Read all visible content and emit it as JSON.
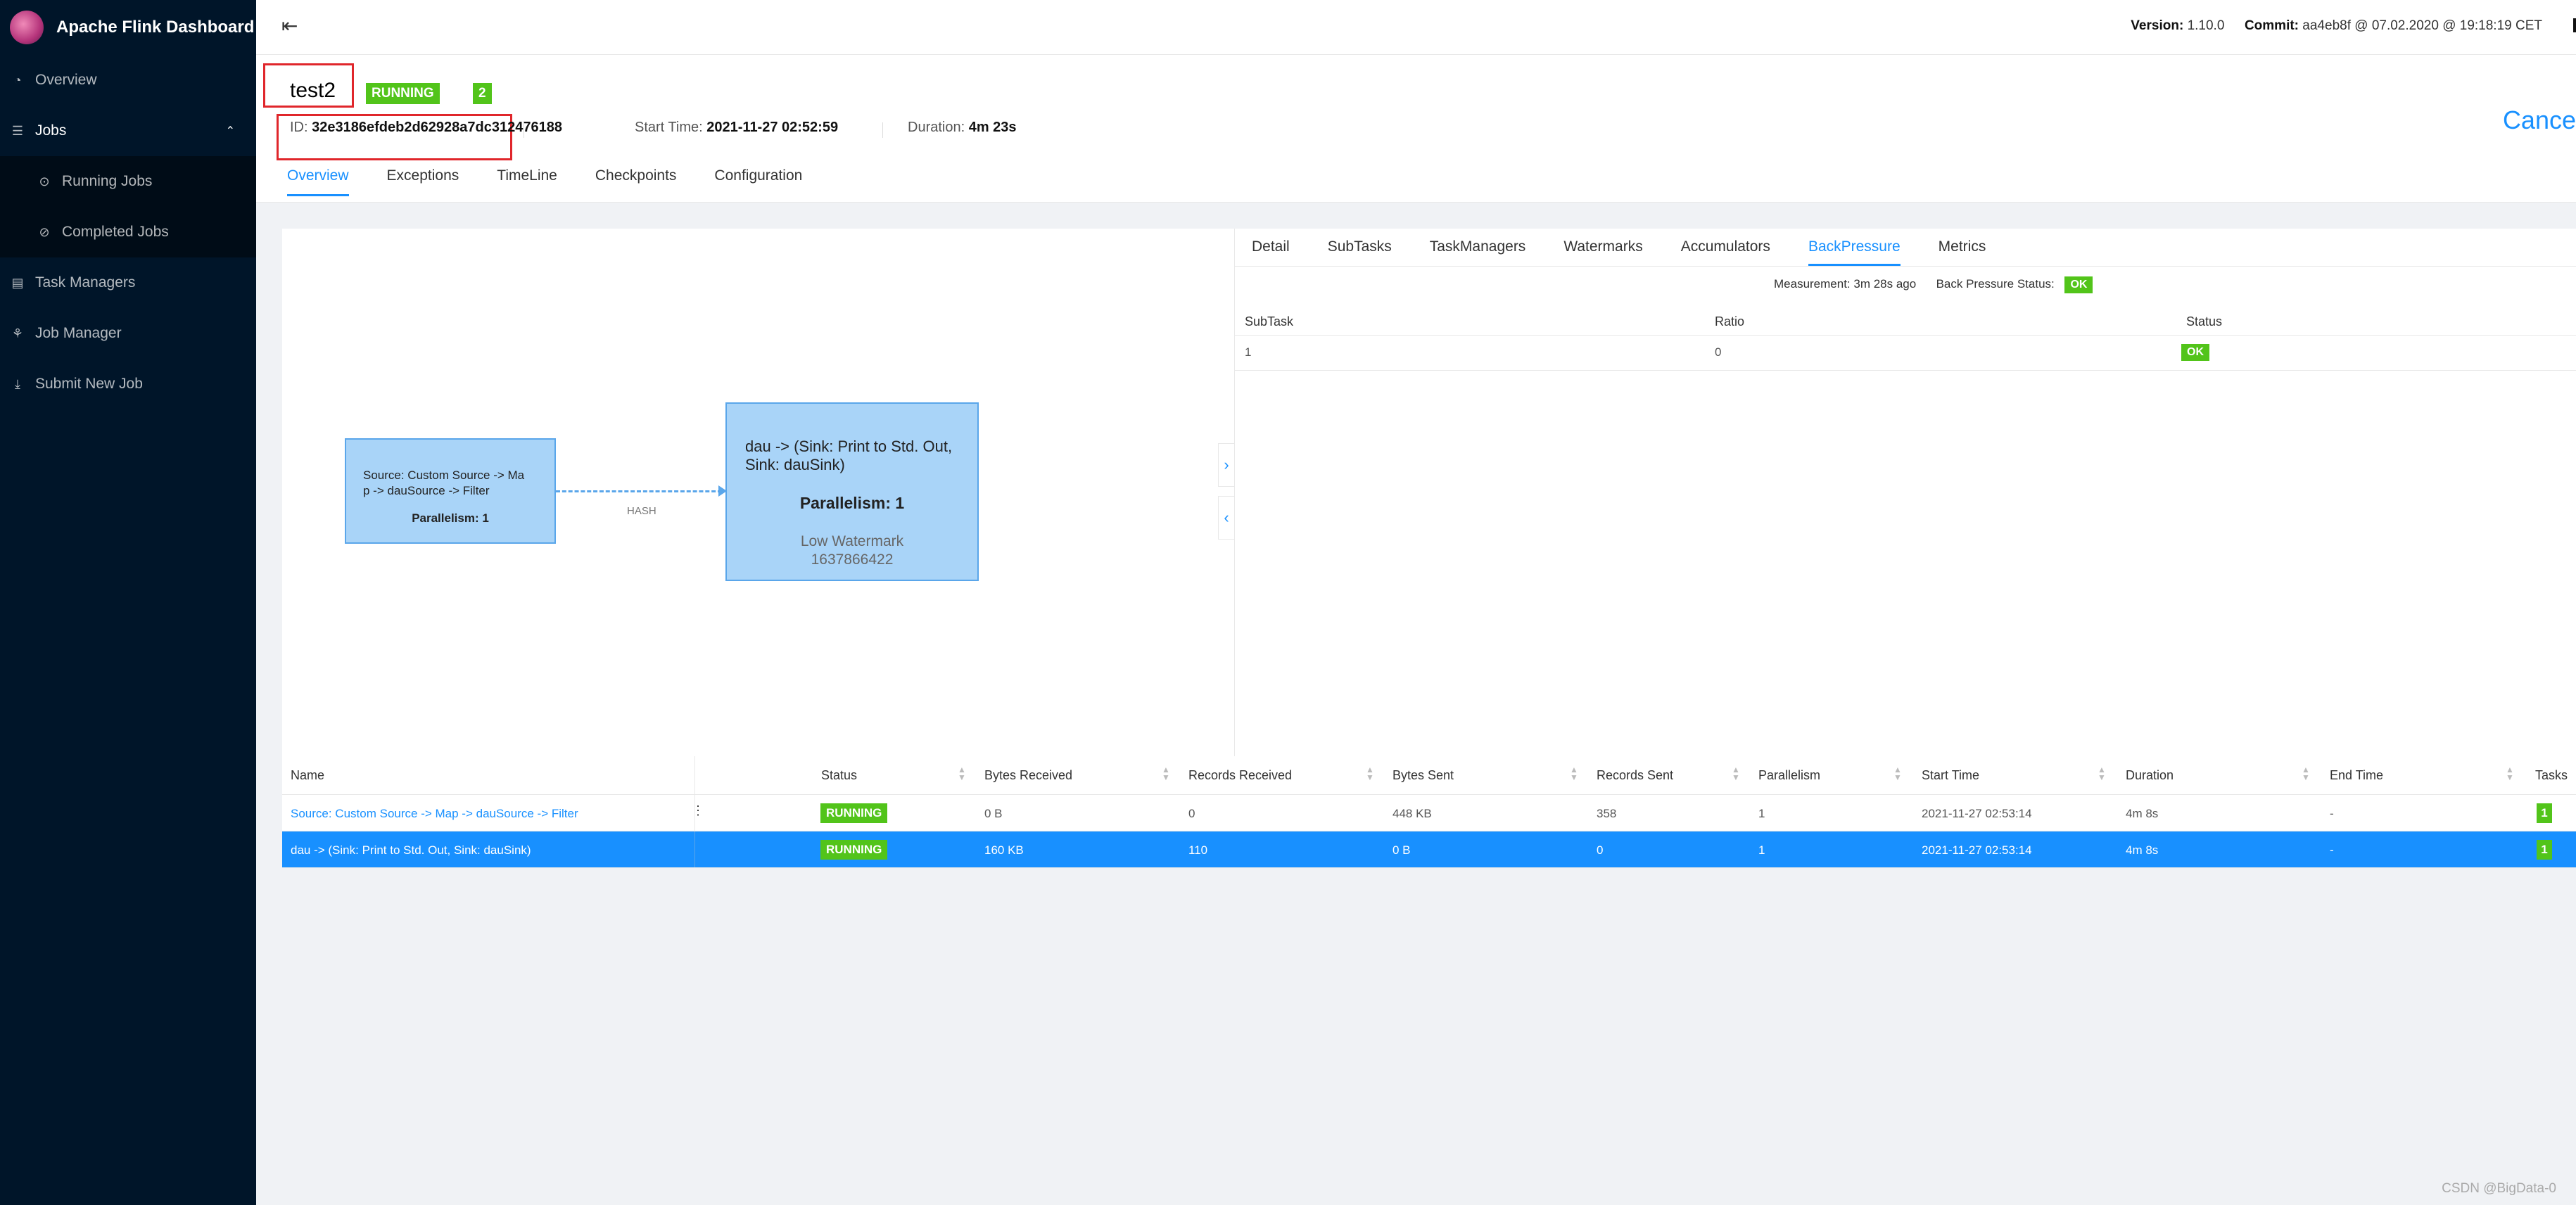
{
  "app": {
    "title": "Apache Flink Dashboard"
  },
  "sidebar": {
    "items": [
      {
        "label": "Overview",
        "icon": "dashboard-icon"
      },
      {
        "label": "Jobs",
        "icon": "jobs-icon"
      },
      {
        "label": "Running Jobs",
        "icon": "play-circle-icon"
      },
      {
        "label": "Completed Jobs",
        "icon": "check-circle-icon"
      },
      {
        "label": "Task Managers",
        "icon": "schedule-icon"
      },
      {
        "label": "Job Manager",
        "icon": "cluster-icon"
      },
      {
        "label": "Submit New Job",
        "icon": "upload-icon"
      }
    ]
  },
  "topbar": {
    "version_label": "Version:",
    "version": "1.10.0",
    "commit_label": "Commit:",
    "commit": "aa4eb8f @ 07.02.2020 @ 19:18:19 CET"
  },
  "job": {
    "name": "test2",
    "status": "RUNNING",
    "count": "2",
    "id_label": "ID:",
    "id": "32e3186efdeb2d62928a7dc312476188",
    "start_label": "Start Time:",
    "start": "2021-11-27 02:52:59",
    "duration_label": "Duration:",
    "duration": "4m 23s",
    "cancel": "Cance"
  },
  "tabs": [
    "Overview",
    "Exceptions",
    "TimeLine",
    "Checkpoints",
    "Configuration"
  ],
  "graph": {
    "node1": {
      "name": "Source: Custom Source -> Map -> dauSource -> Filter",
      "name_l1": "Source: Custom Source -> Ma",
      "name_l2": "p -> dauSource -> Filter",
      "parallelism": "Parallelism: 1"
    },
    "node2": {
      "name_l1": "dau -> (Sink: Print to Std. Out,",
      "name_l2": "Sink: dauSink)",
      "parallelism": "Parallelism: 1",
      "wm_label": "Low Watermark",
      "wm_value": "1637866422"
    },
    "edge_label": "HASH"
  },
  "panel": {
    "tabs": [
      "Detail",
      "SubTasks",
      "TaskManagers",
      "Watermarks",
      "Accumulators",
      "BackPressure",
      "Metrics"
    ],
    "measurement": "Measurement: 3m 28s ago",
    "bp_status_label": "Back Pressure Status:",
    "bp_status": "OK",
    "columns": [
      "SubTask",
      "Ratio",
      "Status"
    ],
    "row": {
      "subtask": "1",
      "ratio": "0",
      "status": "OK"
    }
  },
  "table": {
    "columns": [
      "Name",
      "Status",
      "Bytes Received",
      "Records Received",
      "Bytes Sent",
      "Records Sent",
      "Parallelism",
      "Start Time",
      "Duration",
      "End Time",
      "Tasks"
    ],
    "rows": [
      {
        "name": "Source: Custom Source -> Map -> dauSource -> Filter",
        "status": "RUNNING",
        "bytes_received": "0 B",
        "records_received": "0",
        "bytes_sent": "448 KB",
        "records_sent": "358",
        "parallelism": "1",
        "start_time": "2021-11-27 02:53:14",
        "duration": "4m 8s",
        "end_time": "-",
        "tasks": "1"
      },
      {
        "name": "dau -> (Sink: Print to Std. Out, Sink: dauSink)",
        "status": "RUNNING",
        "bytes_received": "160 KB",
        "records_received": "110",
        "bytes_sent": "0 B",
        "records_sent": "0",
        "parallelism": "1",
        "start_time": "2021-11-27 02:53:14",
        "duration": "4m 8s",
        "end_time": "-",
        "tasks": "1"
      }
    ]
  },
  "watermark_text": "CSDN @BigData-0",
  "colors": {
    "accent": "#1890ff",
    "running": "#52c41a",
    "sidebar": "#001529",
    "highlight": "#e0262b"
  }
}
